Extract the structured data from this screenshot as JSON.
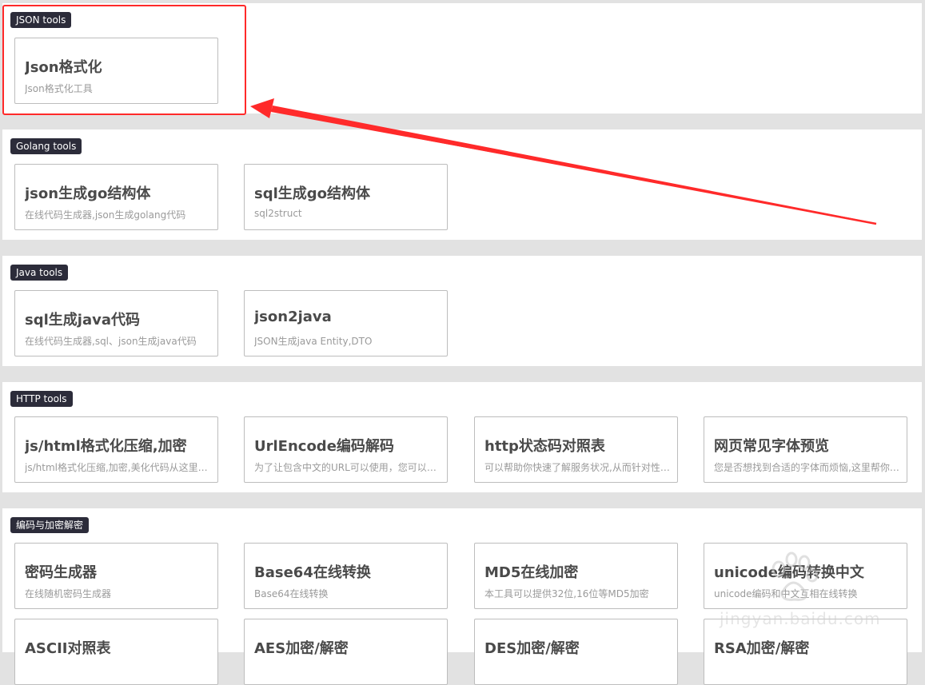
{
  "sections": [
    {
      "badge": "JSON tools",
      "cards": [
        {
          "title": "Json格式化",
          "desc": "Json格式化工具"
        }
      ]
    },
    {
      "badge": "Golang tools",
      "cards": [
        {
          "title": "json生成go结构体",
          "desc": "在线代码生成器,json生成golang代码"
        },
        {
          "title": "sql生成go结构体",
          "desc": "sql2struct"
        }
      ]
    },
    {
      "badge": "Java tools",
      "cards": [
        {
          "title": "sql生成java代码",
          "desc": "在线代码生成器,sql、json生成java代码"
        },
        {
          "title": "json2java",
          "desc": "JSON生成java Entity,DTO"
        }
      ]
    },
    {
      "badge": "HTTP tools",
      "cards": [
        {
          "title": "js/html格式化压缩,加密",
          "desc": "js/html格式化压缩,加密,美化代码从这里开始"
        },
        {
          "title": "UrlEncode编码解码",
          "desc": "为了让包含中文的URL可以使用，您可以使用本工具"
        },
        {
          "title": "http状态码对照表",
          "desc": "可以帮助你快速了解服务状况,从而针对性处理"
        },
        {
          "title": "网页常见字体预览",
          "desc": "您是否想找到合适的字体而烦恼,这里帮你预览"
        }
      ]
    },
    {
      "badge": "编码与加密解密",
      "cards": [
        {
          "title": "密码生成器",
          "desc": "在线随机密码生成器"
        },
        {
          "title": "Base64在线转换",
          "desc": "Base64在线转换"
        },
        {
          "title": "MD5在线加密",
          "desc": "本工具可以提供32位,16位等MD5加密"
        },
        {
          "title": "unicode编码转换中文",
          "desc": "unicode编码和中文互相在线转换"
        },
        {
          "title": "ASCII对照表",
          "desc": ""
        },
        {
          "title": "AES加密/解密",
          "desc": ""
        },
        {
          "title": "DES加密/解密",
          "desc": ""
        },
        {
          "title": "RSA加密/解密",
          "desc": ""
        }
      ]
    }
  ],
  "annotation_color": "#ff2a2a",
  "watermark": {
    "text": "jingyan.baidu.com",
    "icon": "baidu-paw-icon"
  }
}
